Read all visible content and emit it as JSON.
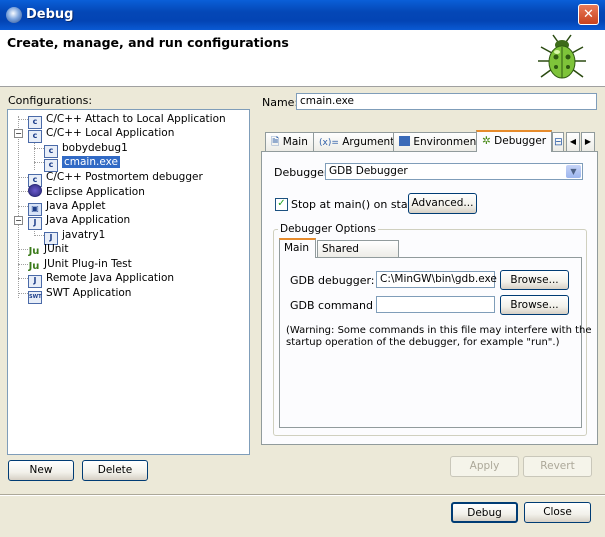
{
  "window": {
    "title": "Debug",
    "close_symbol": "✕"
  },
  "header": {
    "title": "Create, manage, and run configurations",
    "icon": "bug-icon"
  },
  "left": {
    "label": "Configurations:",
    "tree": [
      {
        "label": "C/C++ Attach to Local Application",
        "icon": "c-icon"
      },
      {
        "label": "C/C++ Local Application",
        "icon": "c-icon",
        "expanded": true
      },
      {
        "label": "bobydebug1",
        "icon": "c-icon"
      },
      {
        "label": "cmain.exe",
        "icon": "c-icon",
        "selected": true
      },
      {
        "label": "C/C++ Postmortem debugger",
        "icon": "c-icon"
      },
      {
        "label": "Eclipse Application",
        "icon": "eclipse-icon"
      },
      {
        "label": "Java Applet",
        "icon": "applet-icon"
      },
      {
        "label": "Java Application",
        "icon": "java-icon",
        "expanded": true
      },
      {
        "label": "javatry1",
        "icon": "java-icon"
      },
      {
        "label": "JUnit",
        "icon": "junit-icon"
      },
      {
        "label": "JUnit Plug-in Test",
        "icon": "junit-plugin-icon"
      },
      {
        "label": "Remote Java Application",
        "icon": "remote-java-icon"
      },
      {
        "label": "SWT Application",
        "icon": "swt-icon"
      }
    ],
    "new_button": "New",
    "delete_button": "Delete"
  },
  "right": {
    "name_label": "Name:",
    "name_value": "cmain.exe",
    "tabs": [
      "Main",
      "Arguments",
      "Environment",
      "Debugger"
    ],
    "active_tab": "Debugger",
    "debugger_label": "Debugger:",
    "debugger_value": "GDB Debugger",
    "stop_at_main_label": "Stop at main() on startup",
    "stop_at_main_checked": true,
    "advanced_button": "Advanced...",
    "group_title": "Debugger Options",
    "inner_tabs": [
      "Main",
      "Shared Libraries"
    ],
    "gdb_debugger_label": "GDB debugger:",
    "gdb_debugger_value": "C:\\MinGW\\bin\\gdb.exe",
    "gdb_command_label": "GDB command file:",
    "gdb_command_value": "",
    "browse_button": "Browse...",
    "warning_line1": "(Warning: Some commands in this file may interfere with the",
    "warning_line2": "startup operation of the debugger, for example \"run\".)",
    "apply_button": "Apply",
    "revert_button": "Revert"
  },
  "footer": {
    "debug_button": "Debug",
    "close_button": "Close"
  }
}
